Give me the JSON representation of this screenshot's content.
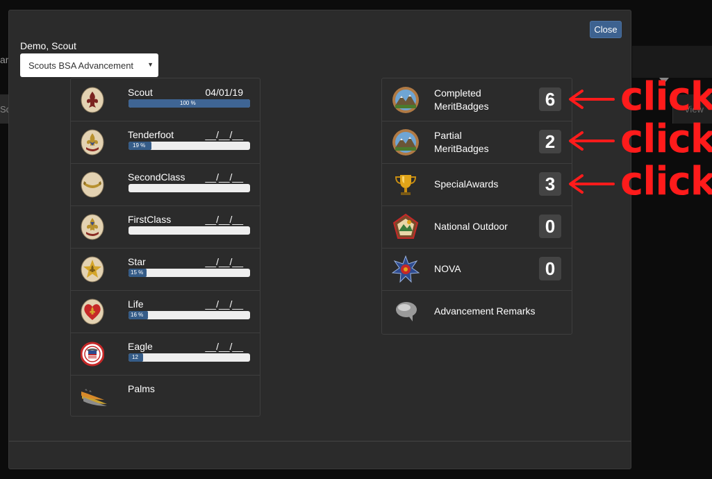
{
  "background": {
    "left_text": "ani",
    "strip_text": "Sc",
    "view_label": "View"
  },
  "modal": {
    "close_label": "Close",
    "scout_name": "Demo, Scout",
    "program_select": {
      "value": "Scouts BSA Advancement"
    }
  },
  "ranks": [
    {
      "name": "Scout",
      "date": "04/01/19",
      "progress": 100,
      "progress_label": "100 %"
    },
    {
      "name": "Tenderfoot",
      "date": "__/__/__",
      "progress": 19,
      "progress_label": "19 %"
    },
    {
      "name": "SecondClass",
      "date": "__/__/__",
      "progress": 0,
      "progress_label": ""
    },
    {
      "name": "FirstClass",
      "date": "__/__/__",
      "progress": 0,
      "progress_label": ""
    },
    {
      "name": "Star",
      "date": "__/__/__",
      "progress": 15,
      "progress_label": "15 %"
    },
    {
      "name": "Life",
      "date": "__/__/__",
      "progress": 16,
      "progress_label": "16 %"
    },
    {
      "name": "Eagle",
      "date": "__/__/__",
      "progress": 12,
      "progress_label": "12"
    },
    {
      "name": "Palms"
    }
  ],
  "awards": [
    {
      "label_line1": "Completed",
      "label_line2": "MeritBadges",
      "count": "6"
    },
    {
      "label_line1": "Partial",
      "label_line2": "MeritBadges",
      "count": "2"
    },
    {
      "label_line1": "SpecialAwards",
      "count": "3"
    },
    {
      "label_line1": "National Outdoor",
      "count": "0"
    },
    {
      "label_line1": "NOVA",
      "count": "0"
    },
    {
      "label_line1": "Advancement Remarks"
    }
  ],
  "annotations": {
    "click_text": "click",
    "color": "#ff1b1b"
  },
  "colors": {
    "modal_bg": "#2b2b2b",
    "progress_fill": "#355c88",
    "close_button": "#3d6290"
  }
}
